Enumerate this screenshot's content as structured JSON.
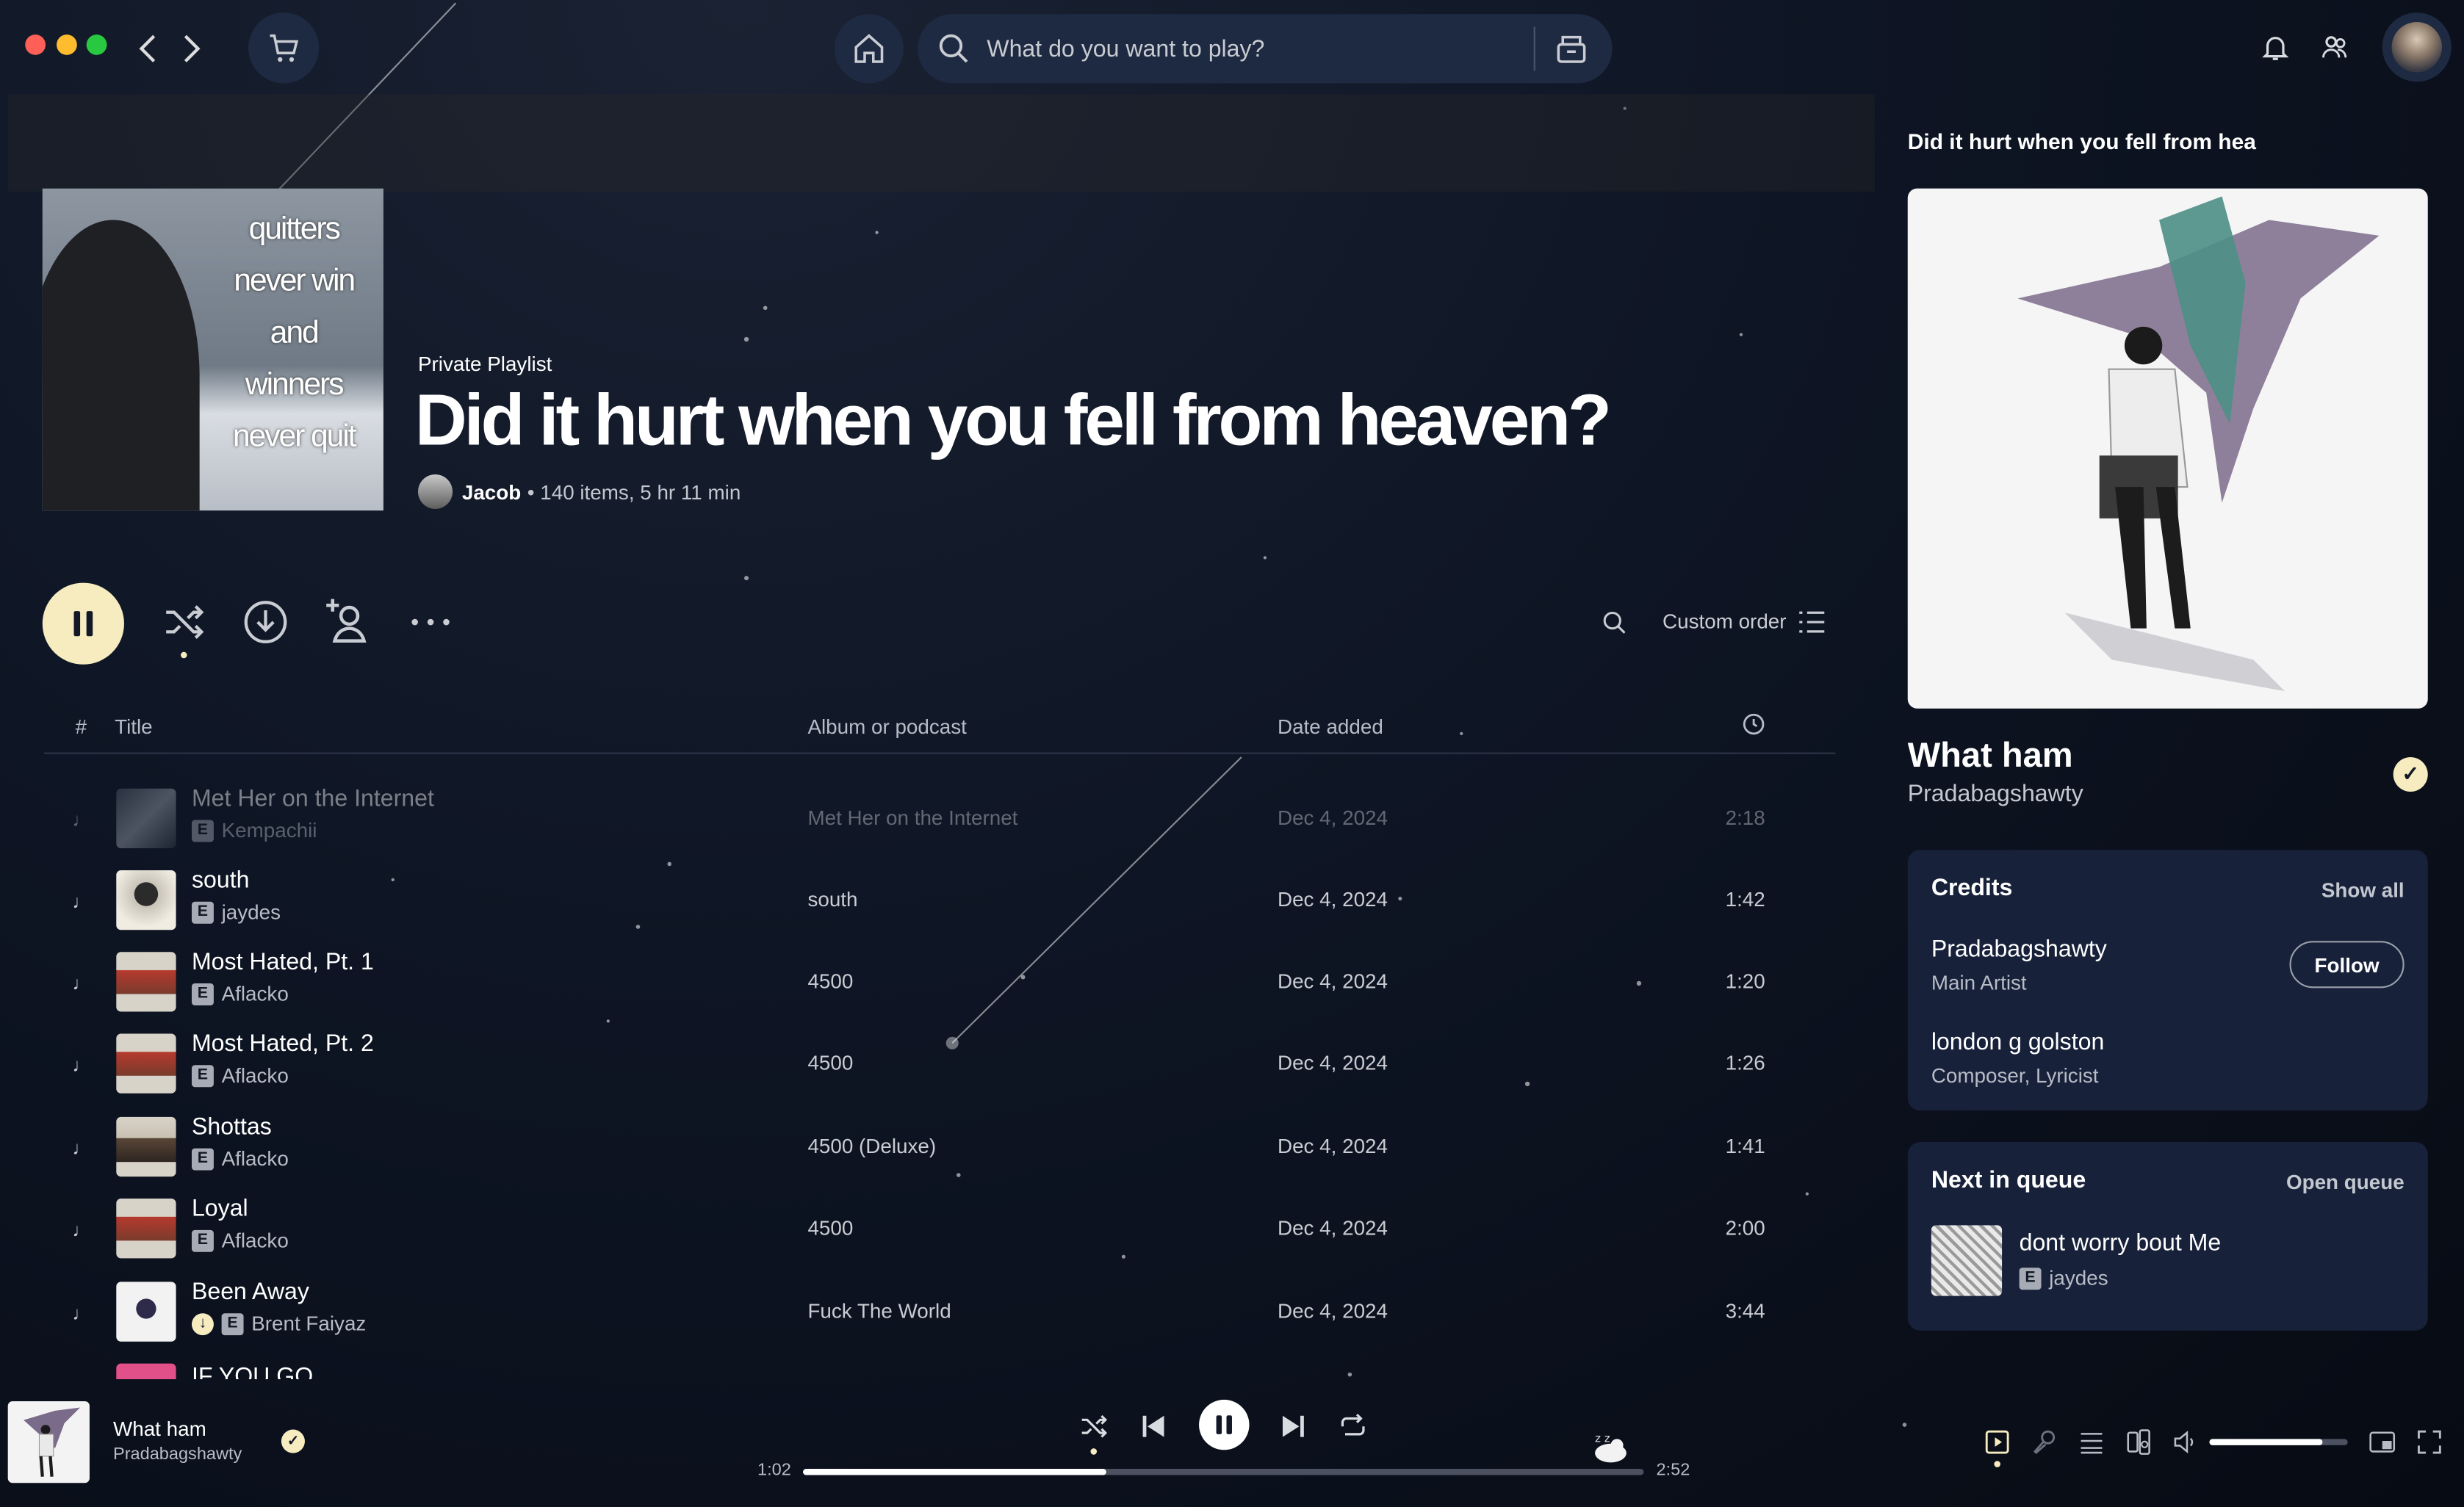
{
  "header": {
    "search_placeholder": "What do you want to play?"
  },
  "playlist": {
    "eyebrow": "Private Playlist",
    "title": "Did it hurt when you fell from heaven?",
    "owner": "Jacob",
    "meta": "• 140 items, 5 hr 11 min",
    "cover_text": [
      "quitters",
      "never win",
      "and",
      "winners",
      "never quit"
    ]
  },
  "toolbar": {
    "sort_label": "Custom order"
  },
  "table": {
    "headers": {
      "num": "#",
      "title": "Title",
      "album": "Album or podcast",
      "date": "Date added"
    },
    "rows": [
      {
        "num": "♩",
        "title": "Met Her on the Internet",
        "artist": "Kempachii",
        "explicit": "E",
        "album": "Met Her on the Internet",
        "date": "Dec 4, 2024",
        "duration": "2:18"
      },
      {
        "num": "♩",
        "title": "south",
        "artist": "jaydes",
        "explicit": "E",
        "album": "south",
        "date": "Dec 4, 2024",
        "duration": "1:42"
      },
      {
        "num": "♩",
        "title": "Most Hated, Pt. 1",
        "artist": "Aflacko",
        "explicit": "E",
        "album": "4500",
        "date": "Dec 4, 2024",
        "duration": "1:20"
      },
      {
        "num": "♩",
        "title": "Most Hated, Pt. 2",
        "artist": "Aflacko",
        "explicit": "E",
        "album": "4500",
        "date": "Dec 4, 2024",
        "duration": "1:26"
      },
      {
        "num": "♩",
        "title": "Shottas",
        "artist": "Aflacko",
        "explicit": "E",
        "album": "4500 (Deluxe)",
        "date": "Dec 4, 2024",
        "duration": "1:41"
      },
      {
        "num": "♩",
        "title": "Loyal",
        "artist": "Aflacko",
        "explicit": "E",
        "album": "4500",
        "date": "Dec 4, 2024",
        "duration": "2:00"
      },
      {
        "num": "♩",
        "title": "Been Away",
        "artist": "Brent Faiyaz",
        "explicit": "E",
        "album": "Fuck The World",
        "date": "Dec 4, 2024",
        "duration": "3:44"
      },
      {
        "num": "♩",
        "title": "IF YOU GO",
        "artist": "",
        "explicit": "",
        "album": "",
        "date": "",
        "duration": ""
      }
    ]
  },
  "now_playing_panel": {
    "header_title": "Did it hurt when you fell from hea",
    "song": "What ham",
    "artist": "Pradabagshawty",
    "credits": {
      "heading": "Credits",
      "show_all": "Show all",
      "people": [
        {
          "name": "Pradabagshawty",
          "role": "Main Artist",
          "follow": "Follow"
        },
        {
          "name": "london g golston",
          "role": "Composer, Lyricist"
        }
      ]
    },
    "queue": {
      "heading": "Next in queue",
      "open": "Open queue",
      "next_title": "dont worry bout Me",
      "next_artist": "jaydes",
      "explicit": "E"
    }
  },
  "player": {
    "song": "What ham",
    "artist": "Pradabagshawty",
    "elapsed": "1:02",
    "total": "2:52",
    "progress": 0.36,
    "volume": 0.82
  },
  "colors": {
    "accent": "#f6ecc0",
    "background": "#0e1524",
    "surface": "#1d2a41"
  }
}
